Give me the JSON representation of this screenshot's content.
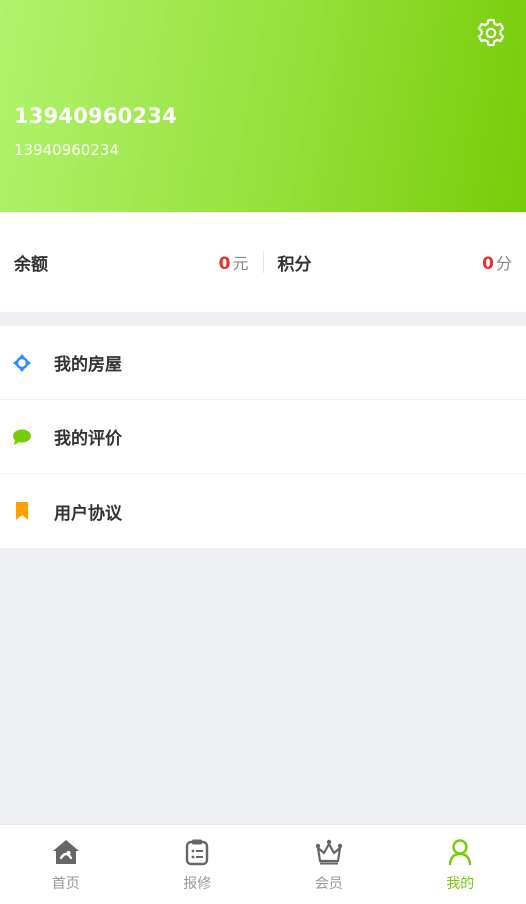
{
  "header": {
    "name": "13940960234",
    "phone": "13940960234"
  },
  "balance": {
    "label": "余额",
    "value": "0",
    "unit": "元"
  },
  "points": {
    "label": "积分",
    "value": "0",
    "unit": "分"
  },
  "menu": {
    "items": [
      {
        "label": "我的房屋",
        "icon": "crosshair-icon",
        "color": "#2a8cff"
      },
      {
        "label": "我的评价",
        "icon": "chat-bubble-icon",
        "color": "#77cc09"
      },
      {
        "label": "用户协议",
        "icon": "bookmark-icon",
        "color": "#ffa000"
      }
    ]
  },
  "tabs": [
    {
      "label": "首页",
      "icon": "home-icon"
    },
    {
      "label": "报修",
      "icon": "clipboard-icon"
    },
    {
      "label": "会员",
      "icon": "crown-icon"
    },
    {
      "label": "我的",
      "icon": "user-icon",
      "active": true
    }
  ],
  "colors": {
    "accent": "#77cc09",
    "header_start": "#b0f36c",
    "header_end": "#77cc09",
    "value_red": "#e8322e",
    "background": "#eff0f4"
  }
}
